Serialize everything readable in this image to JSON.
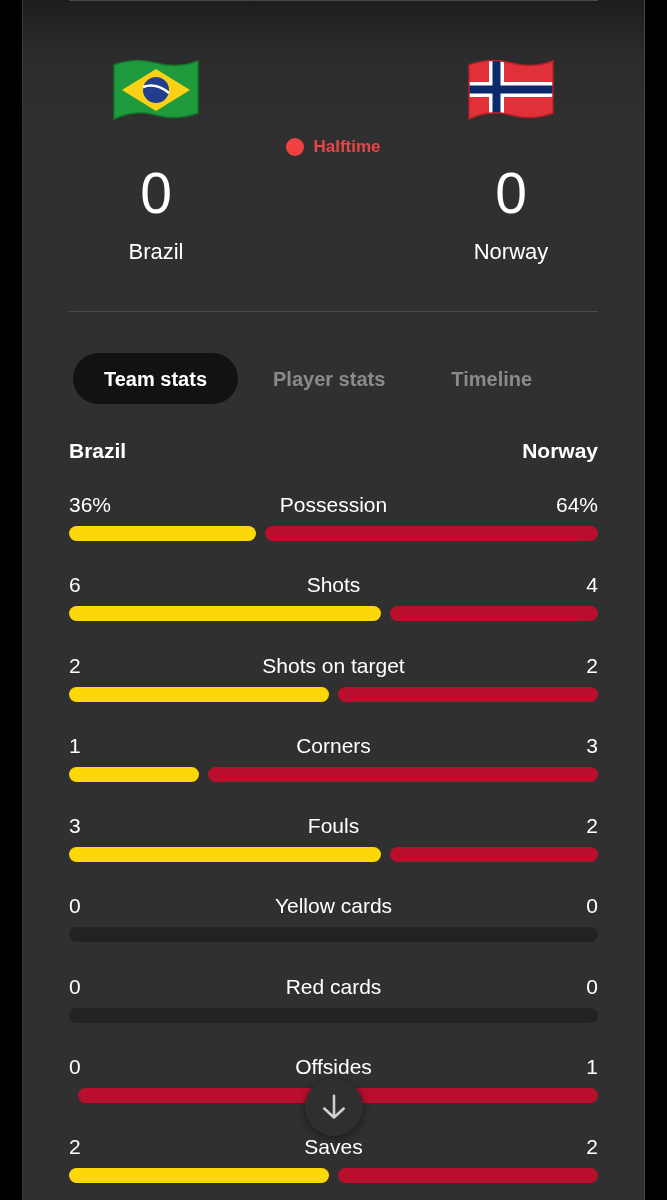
{
  "teams": [
    {
      "name": "Brazil",
      "score": "0",
      "color": "#fdd808"
    },
    {
      "name": "Norway",
      "score": "0",
      "color": "#b90f2d"
    }
  ],
  "status": {
    "label": "Halftime"
  },
  "tabs": [
    {
      "label": "Team stats",
      "selected": true
    },
    {
      "label": "Player stats",
      "selected": false
    },
    {
      "label": "Timeline",
      "selected": false
    }
  ],
  "stats_header": {
    "home": "Brazil",
    "away": "Norway"
  },
  "stats": [
    {
      "label": "Possession",
      "home": "36%",
      "away": "64%",
      "kind": "split",
      "level": 0.36
    },
    {
      "label": "Shots",
      "home": "6",
      "away": "4",
      "kind": "split",
      "level": 0.6
    },
    {
      "label": "Shots on target",
      "home": "2",
      "away": "2",
      "kind": "split",
      "level": 0.5
    },
    {
      "label": "Corners",
      "home": "1",
      "away": "3",
      "kind": "split",
      "level": 0.25
    },
    {
      "label": "Fouls",
      "home": "3",
      "away": "2",
      "kind": "split",
      "level": 0.6
    },
    {
      "label": "Yellow cards",
      "home": "0",
      "away": "0",
      "kind": "empty"
    },
    {
      "label": "Red cards",
      "home": "0",
      "away": "0",
      "kind": "empty"
    },
    {
      "label": "Offsides",
      "home": "0",
      "away": "1",
      "kind": "split",
      "level": 0
    },
    {
      "label": "Saves",
      "home": "2",
      "away": "2",
      "kind": "split",
      "level": 0.5
    }
  ]
}
